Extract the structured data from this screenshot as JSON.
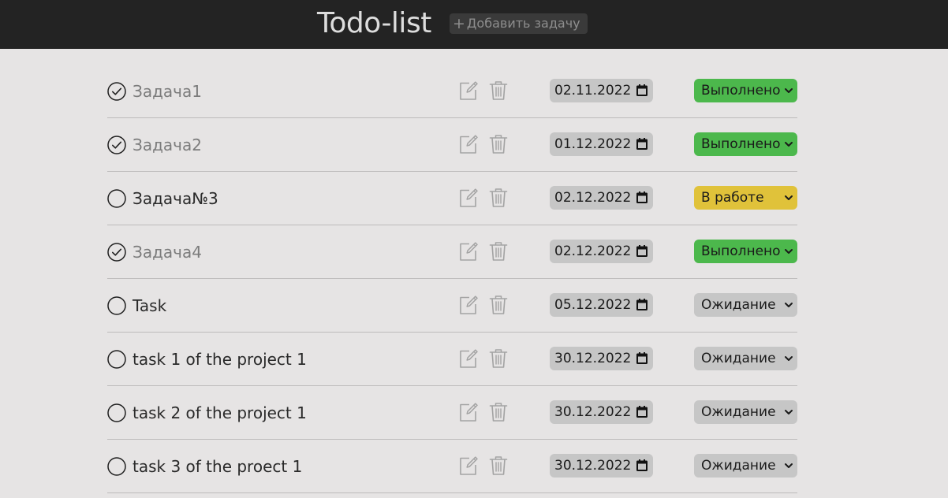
{
  "header": {
    "title": "Todo-list",
    "add_button": {
      "plus": "+",
      "label": "Добавить задачу"
    }
  },
  "tasks": [
    {
      "title": "Задача1",
      "done": true,
      "date": "02.11.2022",
      "status": "Выполнено",
      "status_kind": "done"
    },
    {
      "title": "Задача2",
      "done": true,
      "date": "01.12.2022",
      "status": "Выполнено",
      "status_kind": "done"
    },
    {
      "title": "Задача№3",
      "done": false,
      "date": "02.12.2022",
      "status": "В работе",
      "status_kind": "work"
    },
    {
      "title": "Задача4",
      "done": true,
      "date": "02.12.2022",
      "status": "Выполнено",
      "status_kind": "done"
    },
    {
      "title": "Task",
      "done": false,
      "date": "05.12.2022",
      "status": "Ожидание",
      "status_kind": "wait"
    },
    {
      "title": "task 1 of the project 1",
      "done": false,
      "date": "30.12.2022",
      "status": "Ожидание",
      "status_kind": "wait"
    },
    {
      "title": "task 2 of the project 1",
      "done": false,
      "date": "30.12.2022",
      "status": "Ожидание",
      "status_kind": "wait"
    },
    {
      "title": "task 3 of the proect 1",
      "done": false,
      "date": "30.12.2022",
      "status": "Ожидание",
      "status_kind": "wait"
    }
  ],
  "colors": {
    "header_bg": "#232323",
    "page_bg": "#e6e4e4",
    "status_done": "#4cb84c",
    "status_work": "#e0c23a",
    "status_wait": "#c6c6c6"
  },
  "icons": {
    "check": "check-circle-icon",
    "edit": "edit-icon",
    "delete": "trash-icon",
    "calendar": "calendar-icon",
    "dropdown": "chevron-down-icon"
  }
}
